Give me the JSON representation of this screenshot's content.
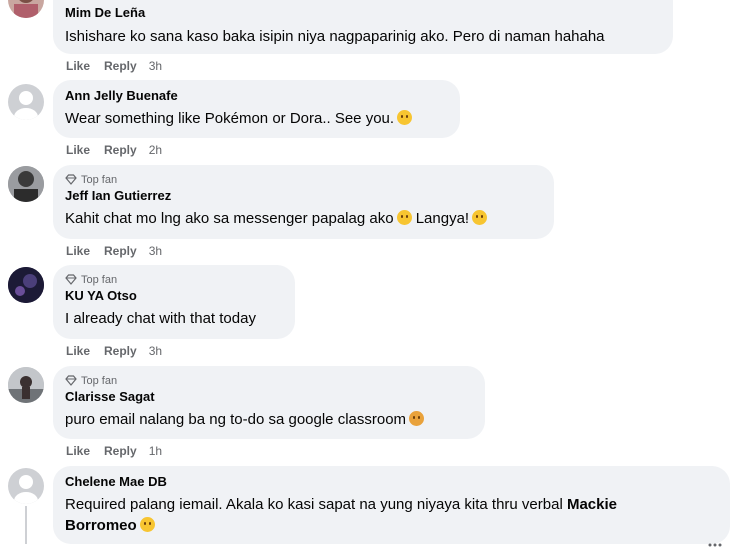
{
  "actions": {
    "like": "Like",
    "reply": "Reply"
  },
  "top_fan_label": "Top fan",
  "comments": [
    {
      "name": "Mim De Leña",
      "text": "Ishishare ko sana kaso baka isipin niya nagpaparinig ako. Pero di naman hahaha",
      "time": "3h",
      "top_fan": false
    },
    {
      "name": "Ann Jelly Buenafe",
      "text": "Wear something like Pokémon or Dora.. See you.",
      "time": "2h",
      "top_fan": false
    },
    {
      "name": "Jeff Ian Gutierrez",
      "text": "Kahit chat mo lng ako sa messenger papalag ako",
      "text2": "Langya!",
      "time": "3h",
      "top_fan": true
    },
    {
      "name": "KU YA Otso",
      "text": "I already chat with that today",
      "time": "3h",
      "top_fan": true
    },
    {
      "name": "Clarisse Sagat",
      "text": "puro email nalang ba ng to-do sa google classroom",
      "time": "1h",
      "top_fan": true
    },
    {
      "name": "Chelene Mae DB",
      "text": "Required palang iemail. Akala ko kasi sapat na yung niyaya kita thru verbal",
      "mention_a": "Mackie",
      "mention_b": "Borromeo",
      "top_fan": false
    }
  ]
}
